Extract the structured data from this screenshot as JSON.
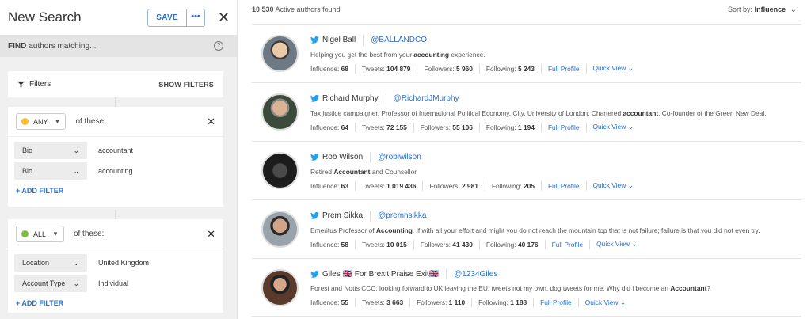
{
  "left": {
    "title": "New Search",
    "save_label": "SAVE",
    "more_label": "•••",
    "close_label": "✕",
    "find_bold": "FIND",
    "find_rest": "authors matching...",
    "help_label": "?",
    "filters_label": "Filters",
    "show_filters": "SHOW FILTERS",
    "groups": [
      {
        "operator": "ANY",
        "dot_color": "#f5c22e",
        "of_these": "of these:",
        "filters": [
          {
            "field": "Bio",
            "value": "accountant"
          },
          {
            "field": "Bio",
            "value": "accounting"
          }
        ],
        "add_filter": "+ ADD FILTER"
      },
      {
        "operator": "ALL",
        "dot_color": "#7cc043",
        "of_these": "of these:",
        "filters": [
          {
            "field": "Location",
            "value": "United Kingdom"
          },
          {
            "field": "Account Type",
            "value": "Individual"
          }
        ],
        "add_filter": "+ ADD FILTER"
      }
    ]
  },
  "right": {
    "count_bold": "10 530",
    "count_rest": "Active authors found",
    "sort_label": "Sort by:",
    "sort_value": "Influence",
    "authors": [
      {
        "name": "Nigel Ball",
        "handle": "@BALLANDCO",
        "bio_pre": "Helping you get the best from your ",
        "bio_bold": "accounting",
        "bio_post": " experience.",
        "influence": "68",
        "tweets": "104 879",
        "followers": "5 960",
        "following": "5 243"
      },
      {
        "name": "Richard Murphy",
        "handle": "@RichardJMurphy",
        "bio_pre": "Tax justice campaigner. Professor of International Political Economy, City, University of London. Chartered ",
        "bio_bold": "accountant",
        "bio_post": ". Co-founder of the Green New Deal.",
        "influence": "64",
        "tweets": "72 155",
        "followers": "55 106",
        "following": "1 194"
      },
      {
        "name": "Rob Wilson",
        "handle": "@roblwilson",
        "bio_pre": "Retired ",
        "bio_bold": "Accountant",
        "bio_post": " and Counsellor",
        "influence": "63",
        "tweets": "1 019 436",
        "followers": "2 981",
        "following": "205"
      },
      {
        "name": "Prem Sikka",
        "handle": "@premnsikka",
        "bio_pre": "Emeritus Professor of ",
        "bio_bold": "Accounting",
        "bio_post": ". If with all your effort and might you do not reach the mountain top that is not failure; failure is that you did not even try.",
        "influence": "58",
        "tweets": "10 015",
        "followers": "41 430",
        "following": "40 176"
      },
      {
        "name": "Giles 🇬🇧 For Brexit Praise Exit🇬🇧",
        "handle": "@1234Giles",
        "bio_pre": "Forest and Notts CCC. looking forward to UK leaving the EU. tweets not my own. dog tweets for me. Why did i become an ",
        "bio_bold": "Accountant",
        "bio_post": "?",
        "influence": "55",
        "tweets": "3 663",
        "followers": "1 110",
        "following": "1 188"
      }
    ],
    "labels": {
      "influence": "Influence:",
      "tweets": "Tweets:",
      "followers": "Followers:",
      "following": "Following:",
      "full_profile": "Full Profile",
      "quick_view": "Quick View"
    }
  }
}
